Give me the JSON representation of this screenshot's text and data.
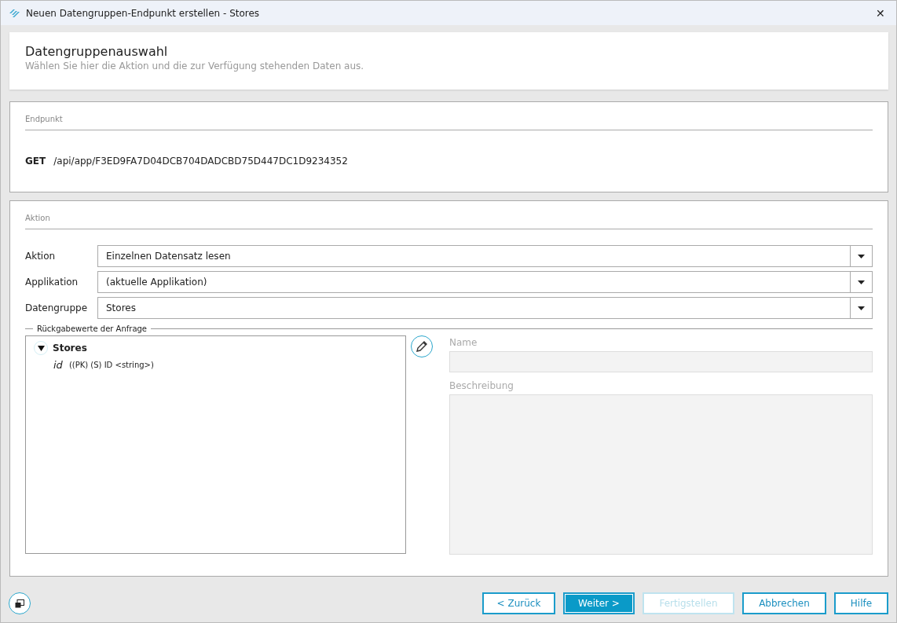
{
  "window": {
    "title": "Neuen Datengruppen-Endpunkt erstellen - Stores",
    "close": "✕"
  },
  "header": {
    "title": "Datengruppenauswahl",
    "subtitle": "Wählen Sie hier die Aktion und die zur Verfügung stehenden Daten aus."
  },
  "endpoint": {
    "legend": "Endpunkt",
    "method": "GET",
    "path": "/api/app/F3ED9FA7D04DCB704DADCBD75D447DC1D9234352"
  },
  "action": {
    "legend": "Aktion",
    "fields": [
      {
        "label": "Aktion",
        "value": "Einzelnen Datensatz lesen"
      },
      {
        "label": "Applikation",
        "value": "(aktuelle Applikation)"
      },
      {
        "label": "Datengruppe",
        "value": "Stores"
      }
    ],
    "returns": {
      "legend": "Rückgabewerte der Anfrage",
      "tree": [
        {
          "name": "Stores",
          "expanded": true,
          "children": [
            {
              "name": "id",
              "description": "((PK) (S) ID <string>)"
            }
          ]
        }
      ]
    },
    "details": [
      {
        "label": "Name",
        "kind": "line",
        "disabled": true
      },
      {
        "label": "Beschreibung",
        "kind": "area",
        "disabled": true
      }
    ]
  },
  "buttons": [
    {
      "label": "< Zurück",
      "kind": "default",
      "disabled": false
    },
    {
      "label": "Weiter >",
      "kind": "primary",
      "disabled": false
    },
    {
      "label": "Fertigstellen",
      "kind": "default",
      "disabled": true
    },
    {
      "label": "Abbrechen",
      "kind": "default",
      "disabled": false
    },
    {
      "label": "Hilfe",
      "kind": "default",
      "disabled": false
    }
  ]
}
